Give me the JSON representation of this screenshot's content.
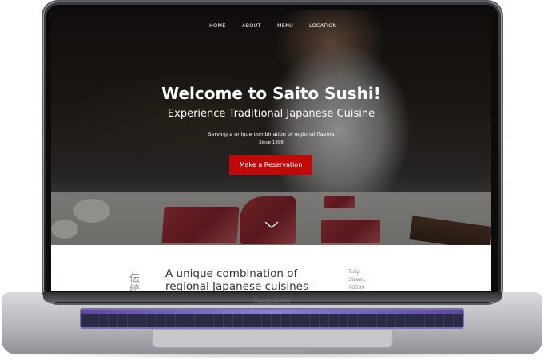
{
  "nav": {
    "home": "HOME",
    "about": "ABOUT",
    "menu": "MENU",
    "location": "LOCATION"
  },
  "hero": {
    "title": "Welcome to Saito Sushi!",
    "subtitle": "Experience Traditional Japanese Cuisine",
    "tagline": "Serving a unique combination of regional flavors",
    "since": "Since 1996",
    "cta_label": "Make a Reservation",
    "scroll_icon": "chevron-down-icon"
  },
  "about": {
    "kanji_line1": "伝",
    "kanji_line2": "統",
    "heading_line1": "A unique combination of",
    "heading_line2": "regional Japanese cuisines -",
    "address_line1": "Tulip",
    "address_line2": "Street,",
    "address_line3": "76589"
  },
  "device": {
    "model_label": "MacBook Pro"
  },
  "colors": {
    "cta": "#c00a0a",
    "hero_text": "#ffffff",
    "body_text": "#333333"
  }
}
